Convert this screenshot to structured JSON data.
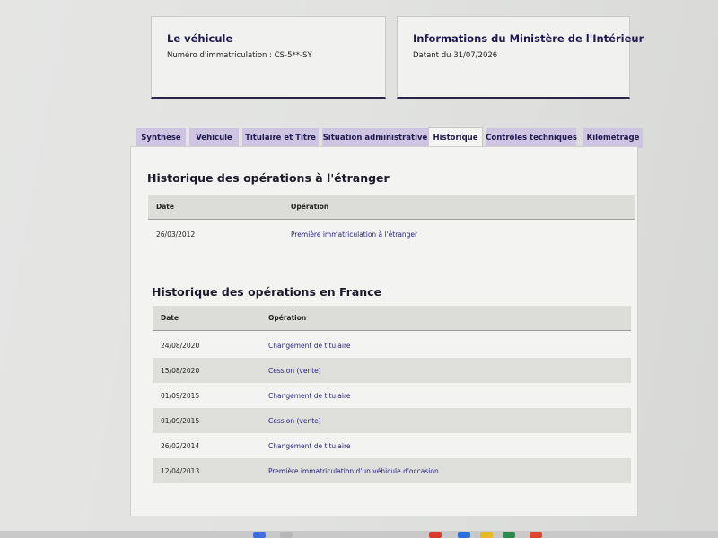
{
  "vehicle_card": {
    "title": "Le véhicule",
    "plate_text": "Numéro d'immatriculation : CS-5**-SY"
  },
  "ministry_card": {
    "title": "Informations du Ministère de l'Intérieur",
    "date_text": "Datant du 31/07/2026"
  },
  "tabs": [
    {
      "label": "Synthèse",
      "active": false
    },
    {
      "label": "Véhicule",
      "active": false
    },
    {
      "label": "Titulaire et Titre",
      "active": false
    },
    {
      "label": "Situation administrative",
      "active": false
    },
    {
      "label": "Historique",
      "active": true
    },
    {
      "label": "Contrôles techniques",
      "active": false
    },
    {
      "label": "Kilométrage",
      "active": false
    }
  ],
  "foreign_history": {
    "title": "Historique des opérations à l'étranger",
    "col_date": "Date",
    "col_operation": "Opération",
    "rows": [
      {
        "date": "26/03/2012",
        "operation": "Première immatriculation à l'étranger"
      }
    ]
  },
  "france_history": {
    "title": "Historique des opérations en France",
    "col_date": "Date",
    "col_operation": "Opération",
    "rows": [
      {
        "date": "24/08/2020",
        "operation": "Changement de titulaire"
      },
      {
        "date": "15/08/2020",
        "operation": "Cession (vente)"
      },
      {
        "date": "01/09/2015",
        "operation": "Changement de titulaire"
      },
      {
        "date": "01/09/2015",
        "operation": "Cession (vente)"
      },
      {
        "date": "26/02/2014",
        "operation": "Changement de titulaire"
      },
      {
        "date": "12/04/2013",
        "operation": "Première immatriculation d'un véhicule d'occasion"
      }
    ]
  },
  "colors": {
    "accent": "#1f1a4f",
    "tab_bg": "#cdc5e2",
    "link": "#2a2480"
  }
}
